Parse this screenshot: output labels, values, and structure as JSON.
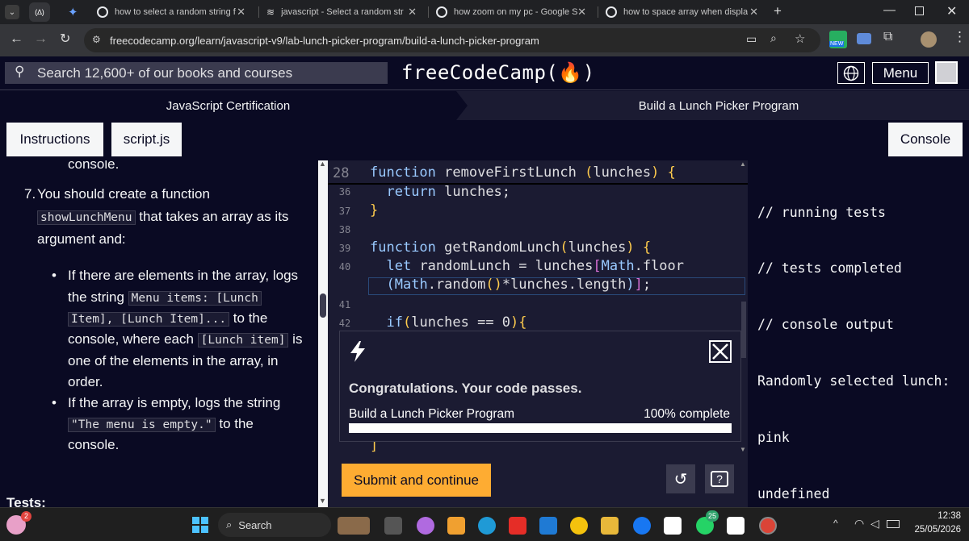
{
  "browser": {
    "tabs": [
      {
        "title": "how to select a random string f"
      },
      {
        "title": "javascript - Select a random str"
      },
      {
        "title": "how zoom on my pc - Google S"
      },
      {
        "title": "how to space array when displa"
      }
    ],
    "url": "freecodecamp.org/learn/javascript-v9/lab-lunch-picker-program/build-a-lunch-picker-program",
    "new_badge": "NEW"
  },
  "fcc": {
    "search_placeholder": "Search 12,600+ of our books and courses",
    "logo": "freeCodeCamp(🔥)",
    "menu_label": "Menu",
    "breadcrumb_left": "JavaScript Certification",
    "breadcrumb_right": "Build a Lunch Picker Program",
    "tab_instructions": "Instructions",
    "tab_script": "script.js",
    "tab_console": "Console"
  },
  "instructions": {
    "top_fragment": "console.",
    "step_number": "7.",
    "step_text_1": "You should create a function",
    "step_code": "showLunchMenu",
    "step_text_2": "that takes an array as its",
    "step_text_3": "argument and:",
    "bullet1_a": "If there are elements in the array, logs",
    "bullet1_b": "the string",
    "bullet1_code1": "Menu items: [Lunch",
    "bullet1_code2": "Item], [Lunch Item]...",
    "bullet1_c": "to the",
    "bullet1_d": "console, where each",
    "bullet1_code3": "[Lunch item]",
    "bullet1_e": "is",
    "bullet1_f": "one of the elements in the array, in",
    "bullet1_g": "order.",
    "bullet2_a": "If the array is empty, logs the string",
    "bullet2_code": "\"The menu is empty.\"",
    "bullet2_b": "to the",
    "bullet2_c": "console.",
    "tests_heading": "Tests:"
  },
  "editor": {
    "sticky_line": "28",
    "lines": [
      {
        "n": "36"
      },
      {
        "n": "37"
      },
      {
        "n": "38"
      },
      {
        "n": "39"
      },
      {
        "n": "40"
      },
      {
        "n": "41"
      },
      {
        "n": "42"
      }
    ]
  },
  "modal": {
    "title": "Congratulations. Your code passes.",
    "project": "Build a Lunch Picker Program",
    "progress_text": "100% complete",
    "progress": 1.0
  },
  "actions": {
    "submit_label": "Submit and continue"
  },
  "console": {
    "lines": [
      "// running tests",
      "// tests completed",
      "// console output",
      "Randomly selected lunch:",
      "pink",
      "undefined"
    ]
  },
  "taskbar": {
    "search_label": "Search",
    "time": "12:38",
    "date": "25/05/2026",
    "notification_count": "2",
    "whatsapp_badge": "25"
  },
  "colors": {
    "fcc_bg": "#0a0a23",
    "panel": "#1b1b32",
    "submit": "#feac32",
    "keyword": "#99c9ff",
    "bracket": "#da70d6"
  }
}
